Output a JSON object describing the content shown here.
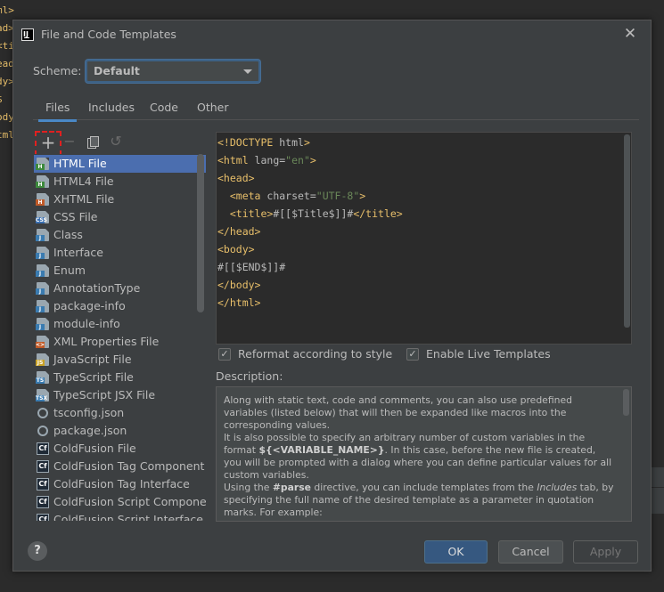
{
  "background_editor": {
    "lines": [
      "ml>",
      "ad>",
      "<ti",
      "ead",
      "dy>",
      "$",
      "ody",
      "tml"
    ]
  },
  "dialog": {
    "title": "File and Code Templates",
    "close_glyph": "✕"
  },
  "scheme": {
    "label": "Scheme:",
    "value": "Default"
  },
  "tabs": [
    {
      "label": "Files",
      "active": true
    },
    {
      "label": "Includes",
      "active": false
    },
    {
      "label": "Code",
      "active": false
    },
    {
      "label": "Other",
      "active": false
    }
  ],
  "toolbar": {
    "add_glyph": "+",
    "remove_glyph": "−",
    "reset_glyph": "↺"
  },
  "files": [
    {
      "label": "HTML File",
      "icon": "html-icon",
      "tag": "H",
      "tag_color": "#3d8a3d",
      "selected": true
    },
    {
      "label": "HTML4 File",
      "icon": "html-icon",
      "tag": "H",
      "tag_color": "#3d8a3d"
    },
    {
      "label": "XHTML File",
      "icon": "xhtml-icon",
      "tag": "H",
      "tag_color": "#c05a28"
    },
    {
      "label": "CSS File",
      "icon": "css-icon",
      "tag": "CSS",
      "tag_color": "#3a6fb0"
    },
    {
      "label": "Class",
      "icon": "java-icon",
      "tag": "J",
      "tag_color": "#3a7bb0"
    },
    {
      "label": "Interface",
      "icon": "java-icon",
      "tag": "J",
      "tag_color": "#3a7bb0"
    },
    {
      "label": "Enum",
      "icon": "java-icon",
      "tag": "J",
      "tag_color": "#3a7bb0"
    },
    {
      "label": "AnnotationType",
      "icon": "java-icon",
      "tag": "J",
      "tag_color": "#3a7bb0"
    },
    {
      "label": "package-info",
      "icon": "java-icon",
      "tag": "J",
      "tag_color": "#3a7bb0"
    },
    {
      "label": "module-info",
      "icon": "java-icon",
      "tag": "J",
      "tag_color": "#3a7bb0"
    },
    {
      "label": "XML Properties File",
      "icon": "xml-icon",
      "tag": "<>",
      "tag_color": "#c05a28"
    },
    {
      "label": "JavaScript File",
      "icon": "javascript-icon",
      "tag": "JS",
      "tag_color": "#c9a227"
    },
    {
      "label": "TypeScript File",
      "icon": "typescript-icon",
      "tag": "TS",
      "tag_color": "#3a7bb0"
    },
    {
      "label": "TypeScript JSX File",
      "icon": "tsx-icon",
      "tag": "TSX",
      "tag_color": "#3a7bb0"
    },
    {
      "label": "tsconfig.json",
      "icon": "config-icon",
      "tag": "",
      "tag_color": "#9aa7b0"
    },
    {
      "label": "package.json",
      "icon": "config-icon",
      "tag": "",
      "tag_color": "#9aa7b0"
    },
    {
      "label": "ColdFusion File",
      "icon": "coldfusion-icon",
      "tag": "Cf",
      "tag_color": "#1f2a36"
    },
    {
      "label": "ColdFusion Tag Component",
      "icon": "coldfusion-icon",
      "tag": "Cf",
      "tag_color": "#1f2a36"
    },
    {
      "label": "ColdFusion Tag Interface",
      "icon": "coldfusion-icon",
      "tag": "Cf",
      "tag_color": "#1f2a36"
    },
    {
      "label": "ColdFusion Script Component",
      "icon": "coldfusion-icon",
      "tag": "Cf",
      "tag_color": "#1f2a36"
    },
    {
      "label": "ColdFusion Script Interface",
      "icon": "coldfusion-icon",
      "tag": "Cf",
      "tag_color": "#1f2a36"
    }
  ],
  "editor": {
    "lines": [
      [
        {
          "t": "<!DOCTYPE ",
          "c": "tg"
        },
        {
          "t": "html",
          "c": "at"
        },
        {
          "t": ">",
          "c": "tg"
        }
      ],
      [
        {
          "t": "<html ",
          "c": "tg"
        },
        {
          "t": "lang=",
          "c": "at"
        },
        {
          "t": "\"en\"",
          "c": "sv"
        },
        {
          "t": ">",
          "c": "tg"
        }
      ],
      [
        {
          "t": "<head>",
          "c": "tg"
        }
      ],
      [
        {
          "t": "  <meta ",
          "c": "tg"
        },
        {
          "t": "charset=",
          "c": "at"
        },
        {
          "t": "\"UTF-8\"",
          "c": "sv"
        },
        {
          "t": ">",
          "c": "tg"
        }
      ],
      [
        {
          "t": "  <title>",
          "c": "tg"
        },
        {
          "t": "#[[$Title$]]#",
          "c": "at"
        },
        {
          "t": "</title>",
          "c": "tg"
        }
      ],
      [
        {
          "t": "</head>",
          "c": "tg"
        }
      ],
      [
        {
          "t": "<body>",
          "c": "tg"
        }
      ],
      [
        {
          "t": "#[[$END$]]#",
          "c": "at"
        }
      ],
      [
        {
          "t": "</body>",
          "c": "tg"
        }
      ],
      [
        {
          "t": "</html>",
          "c": "tg"
        }
      ]
    ]
  },
  "options": {
    "reformat_label": "Reformat according to style",
    "reformat_checked": true,
    "live_templates_label": "Enable Live Templates",
    "live_templates_checked": true
  },
  "description": {
    "label": "Description:",
    "p1": "Along with static text, code and comments, you can also use predefined variables (listed below) that will then be expanded like macros into the corresponding values.",
    "p2_a": "It is also possible to specify an arbitrary number of custom variables in the format ",
    "p2_b": "${<VARIABLE_NAME>}",
    "p2_c": ". In this case, before the new file is created, you will be prompted with a dialog where you can define particular values for all custom variables.",
    "p3_a": "Using the ",
    "p3_b": "#parse",
    "p3_c": " directive, you can include templates from the ",
    "p3_d": "Includes",
    "p3_e": " tab, by specifying the full name of the desired template as a parameter in quotation marks. For example:"
  },
  "buttons": {
    "help": "?",
    "ok": "OK",
    "cancel": "Cancel",
    "apply": "Apply"
  },
  "colors": {
    "selection": "#4b6eaf",
    "accent": "#4a88c7",
    "highlight_box": "#e02020"
  }
}
